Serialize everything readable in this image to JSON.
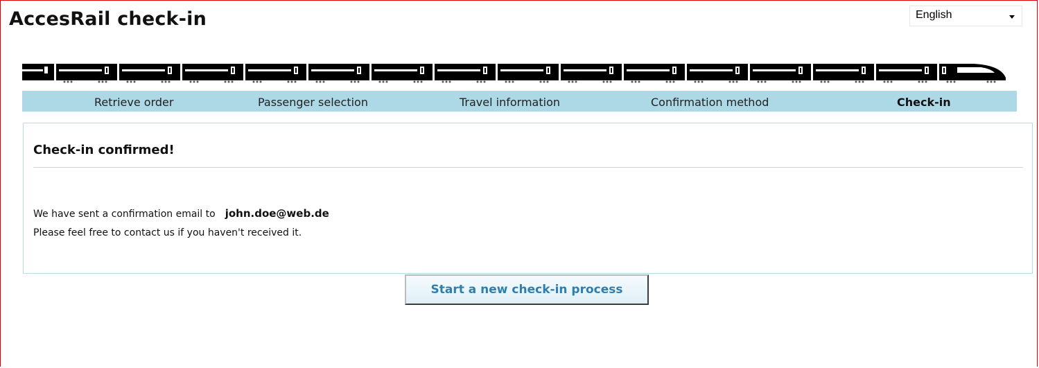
{
  "header": {
    "title": "AccesRail check-in"
  },
  "language": {
    "selected": "English"
  },
  "progress": {
    "steps": [
      {
        "label": "Retrieve order",
        "active": false
      },
      {
        "label": "Passenger selection",
        "active": false
      },
      {
        "label": "Travel information",
        "active": false
      },
      {
        "label": "Confirmation method",
        "active": false
      },
      {
        "label": "Check-in",
        "active": true
      }
    ],
    "current_step": 5,
    "total_steps": 5
  },
  "confirmation": {
    "heading": "Check-in confirmed!",
    "line1_prefix": "We have sent a confirmation email to",
    "email": "john.doe@web.de",
    "line2": "Please feel free to contact us if you haven't received it."
  },
  "actions": {
    "new_checkin_label": "Start a new check-in process"
  },
  "colors": {
    "step_bar": "#add8e6",
    "panel_border": "#b8dbe8",
    "button_text": "#2f7fae",
    "frame": "#e00000"
  }
}
